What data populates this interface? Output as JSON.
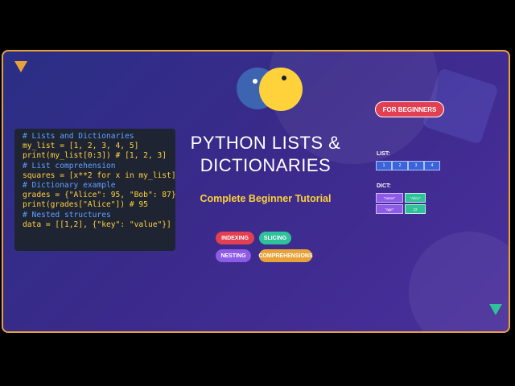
{
  "code_lines": [
    {
      "text": "# Lists and Dictionaries",
      "kind": "comment"
    },
    {
      "text": "my_list = [1, 2, 3, 4, 5]",
      "kind": "code"
    },
    {
      "text": "print(my_list[0:3]) # [1, 2, 3]",
      "kind": "code"
    },
    {
      "text": "# List comprehension",
      "kind": "comment"
    },
    {
      "text": "squares = [x**2 for x in my_list]",
      "kind": "code"
    },
    {
      "text": "# Dictionary example",
      "kind": "comment"
    },
    {
      "text": "grades = {\"Alice\": 95, \"Bob\": 87}",
      "kind": "code"
    },
    {
      "text": "print(grades[\"Alice\"]) # 95",
      "kind": "code"
    },
    {
      "text": "# Nested structures",
      "kind": "comment"
    },
    {
      "text": "data = [[1,2], {\"key\": \"value\"}]",
      "kind": "code"
    }
  ],
  "title_line1": "PYTHON LISTS &",
  "title_line2": "DICTIONARIES",
  "subtitle": "Complete Beginner Tutorial",
  "badge": "FOR BEGINNERS",
  "tags": {
    "indexing": "INDEXING",
    "slicing": "SLICING",
    "nesting": "NESTING",
    "comprehensions": "COMPREHENSIONS"
  },
  "list_label": "LIST:",
  "list_values": [
    "1",
    "2",
    "3",
    "4"
  ],
  "dict_label": "DICT:",
  "dict_rows": [
    {
      "key": "\"name\"",
      "value": "\"Alice\""
    },
    {
      "key": "\"age\"",
      "value": "22"
    }
  ],
  "colors": {
    "accent_orange": "#e8a23a",
    "python_blue": "#3c64b0",
    "python_yellow": "#ffd23c",
    "badge_red": "#e24052",
    "tag_red": "#e24052",
    "tag_green": "#2fc19a",
    "tag_purple": "#8e5be6",
    "tag_orange": "#e8a23a"
  }
}
